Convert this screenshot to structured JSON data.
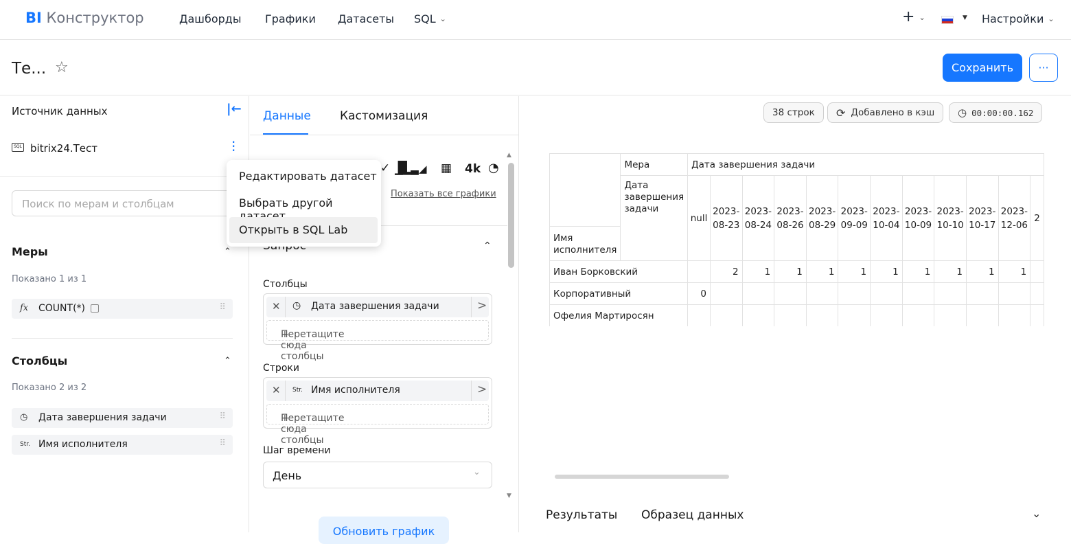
{
  "header": {
    "brand_bi": "BI",
    "brand_name": "Конструктор",
    "nav": [
      "Дашборды",
      "Графики",
      "Датасеты",
      "SQL"
    ],
    "plus_label": "+",
    "settings_label": "Настройки"
  },
  "titlebar": {
    "title": "Те...",
    "save_label": "Сохранить",
    "more_label": "···"
  },
  "left": {
    "source_label": "Источник данных",
    "dataset_name": "bitrix24.Тест",
    "search_placeholder": "Поиск по мерам и столбцам",
    "measures_title": "Меры",
    "measures_shown": "Показано 1 из 1",
    "measures": [
      "COUNT(*)"
    ],
    "columns_title": "Столбцы",
    "columns_shown": "Показано 2 из 2",
    "columns": [
      {
        "icon": "clock-icon",
        "label": "Дата завершения задачи"
      },
      {
        "icon": "string-icon",
        "label": "Имя исполнителя"
      }
    ]
  },
  "dataset_menu": [
    "Редактировать датасет",
    "Выбрать другой датасет",
    "Открыть в SQL Lab"
  ],
  "middle": {
    "tab_data": "Данные",
    "tab_custom": "Кастомизация",
    "show_all_charts": "Показать все графики",
    "chart_4k": "4k",
    "query_title": "Запрос",
    "columns_label": "Столбцы",
    "column_value": "Дата завершения задачи",
    "rows_label": "Строки",
    "row_value": "Имя исполнителя",
    "drop_hint": "Перетащите сюда столбцы",
    "time_step_label": "Шаг времени",
    "time_step_value": "День",
    "update_label": "Обновить график"
  },
  "right": {
    "rows_count": "38 строк",
    "cache_label": "Добавлено в кэш",
    "timer": "00:00:00.162",
    "pivot": {
      "measure_label": "Мера",
      "col_header": "Дата завершения задачи",
      "col_dim_label": "Дата завершения задачи",
      "row_dim_label": "Имя исполнителя",
      "dates": [
        "null",
        "2023-08-23",
        "2023-08-24",
        "2023-08-26",
        "2023-08-29",
        "2023-09-09",
        "2023-10-04",
        "2023-10-09",
        "2023-10-10",
        "2023-10-17",
        "2023-12-06",
        "2"
      ],
      "rows": [
        {
          "name": "Иван Борковский",
          "values": [
            "",
            "2",
            "1",
            "1",
            "1",
            "1",
            "1",
            "1",
            "1",
            "1",
            "1",
            ""
          ]
        },
        {
          "name": "Корпоративный",
          "values": [
            "0",
            "",
            "",
            "",
            "",
            "",
            "",
            "",
            "",
            "",
            "",
            ""
          ]
        },
        {
          "name": "Офелия Мартиросян",
          "values": [
            "",
            "",
            "",
            "",
            "",
            "",
            "",
            "",
            "",
            "",
            "",
            ""
          ]
        }
      ]
    },
    "results_tab": "Результаты",
    "sample_tab": "Образец данных"
  },
  "colors": {
    "accent": "#1677ff"
  }
}
